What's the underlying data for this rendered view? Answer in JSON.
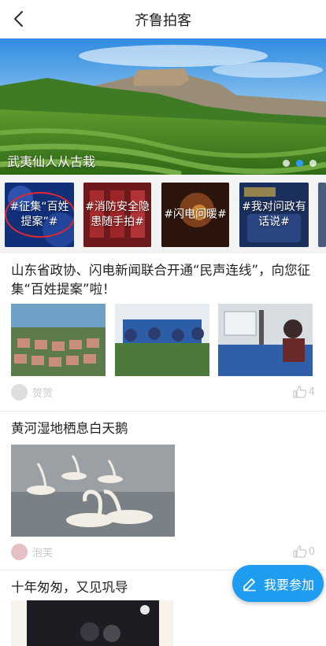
{
  "header": {
    "title": "齐鲁拍客",
    "back_icon": "back-arrow-icon"
  },
  "banner": {
    "caption": "武夷仙人从古栽",
    "slide_count": 3,
    "active_index": 1,
    "accent": "#2b9df2"
  },
  "topics": [
    {
      "label": "#征集“百姓提案”#"
    },
    {
      "label": "#消防安全隐患随手拍#"
    },
    {
      "label": "#闪电问暖#"
    },
    {
      "label": "#我对问政有话说#"
    }
  ],
  "posts": [
    {
      "title": "山东省政协、闪电新闻联合开通“民声连线”，向您征集“百姓提案”啦！",
      "user": "贺贺",
      "likes": "4"
    },
    {
      "title": "黄河湿地栖息白天鹅",
      "user": "泡芙",
      "likes": "0"
    },
    {
      "title": "十年匆匆，又见巩导"
    }
  ],
  "fab": {
    "label": "我要参加",
    "icon": "edit-pencil-icon",
    "color": "#1e9cf0"
  }
}
